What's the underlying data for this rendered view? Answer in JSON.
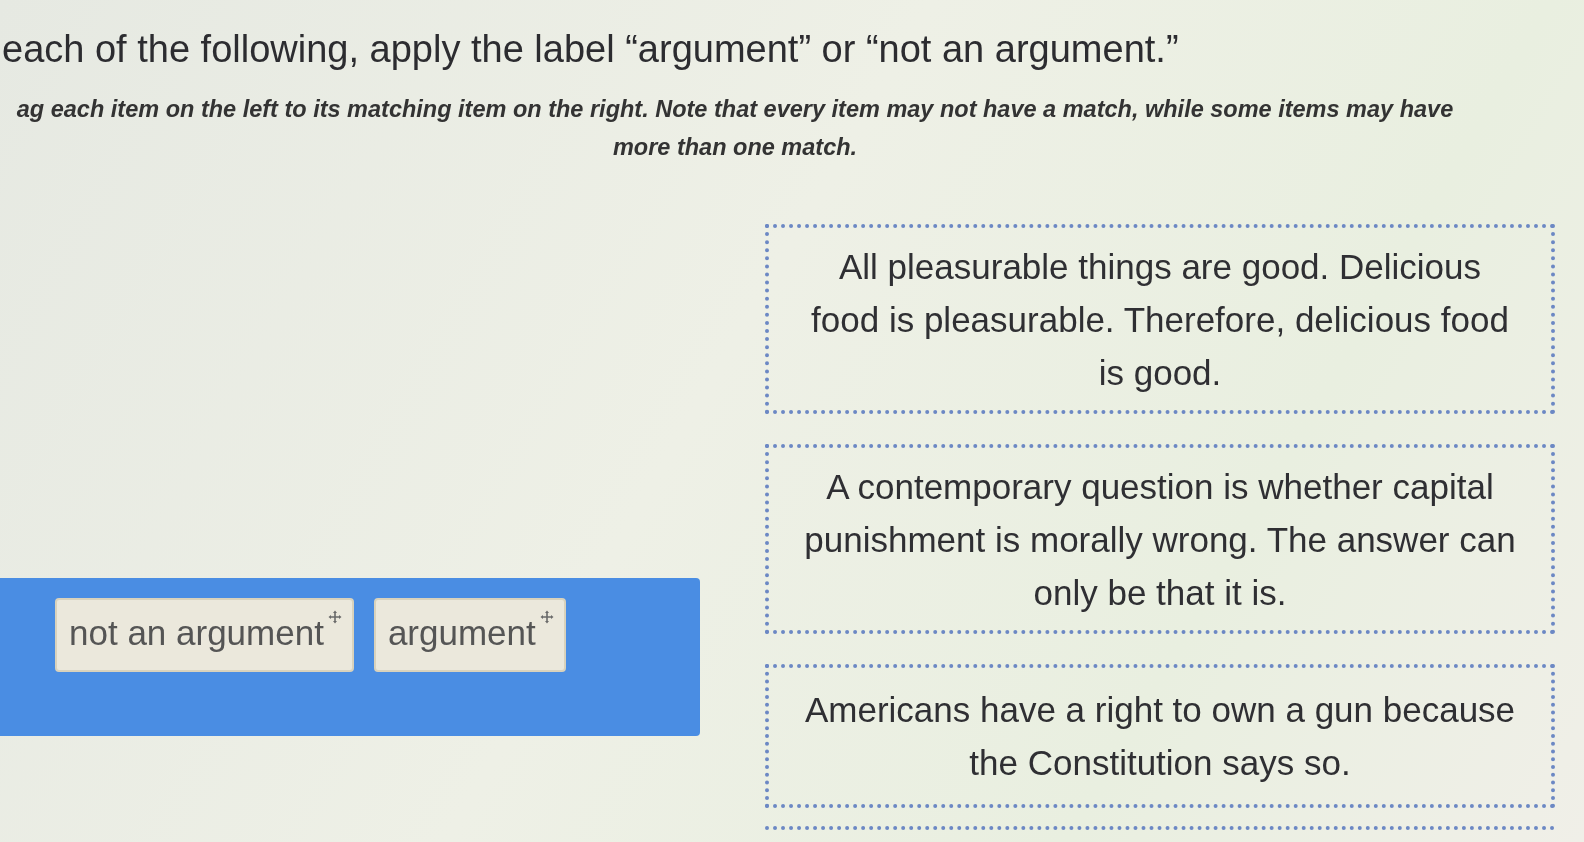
{
  "prompt": {
    "title": "each of the following, apply the label “argument” or “not an argument.”",
    "instructions": [
      "ag each item on the left to its matching item on the right. Note that every item may not have a match, while some items may have",
      "more than one match."
    ]
  },
  "choices": [
    {
      "label": "not an argument"
    },
    {
      "label": "argument"
    }
  ],
  "targets": [
    {
      "text": "All pleasurable things are good. Delicious food is pleasurable. Therefore, delicious food is good."
    },
    {
      "text": "A contemporary question is whether capital punishment is morally wrong. The answer can only be that it is."
    },
    {
      "text": "Americans have a right to own a gun because the Constitution says so."
    }
  ]
}
